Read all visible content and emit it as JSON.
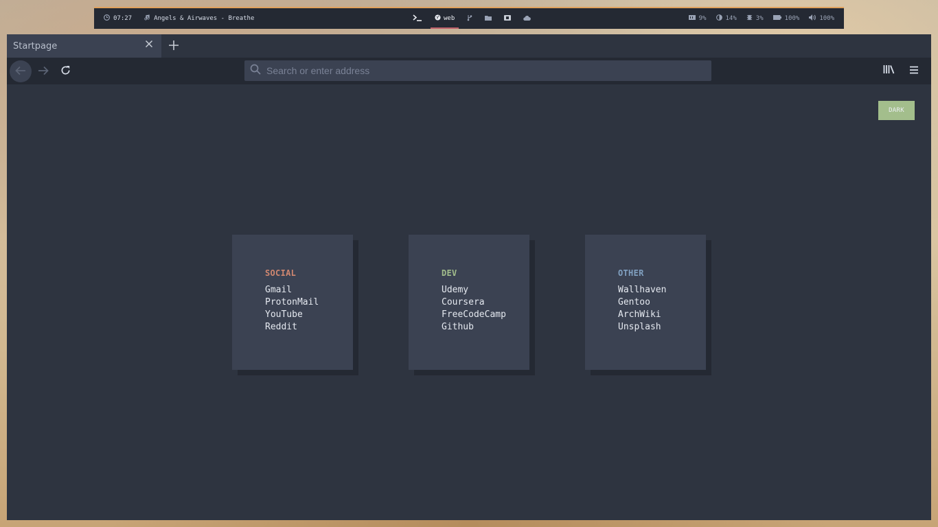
{
  "topbar": {
    "time": "07:27",
    "now_playing": "Angels & Airwaves - Breathe",
    "workspaces": [
      {
        "label": "",
        "icon": "terminal-icon"
      },
      {
        "label": "web",
        "icon": "globe-icon"
      },
      {
        "label": "",
        "icon": "git-branch-icon"
      },
      {
        "label": "",
        "icon": "folder-icon"
      },
      {
        "label": "",
        "icon": "film-icon"
      },
      {
        "label": "",
        "icon": "cloud-icon"
      }
    ],
    "stats": {
      "memory": "9%",
      "cpu": "14%",
      "disk": "3%",
      "battery": "100%",
      "volume": "100%"
    },
    "accent": "#bf616a"
  },
  "browser": {
    "tab_title": "Startpage",
    "url_placeholder": "Search or enter address"
  },
  "startpage": {
    "theme_button": "DARK",
    "theme_button_color": "#a3be8c",
    "cards": [
      {
        "title": "SOCIAL",
        "color": "#d08770",
        "links": [
          "Gmail",
          "ProtonMail",
          "YouTube",
          "Reddit"
        ]
      },
      {
        "title": "DEV",
        "color": "#a3be8c",
        "links": [
          "Udemy",
          "Coursera",
          "FreeCodeCamp",
          "Github"
        ]
      },
      {
        "title": "OTHER",
        "color": "#81a1c1",
        "links": [
          "Wallhaven",
          "Gentoo",
          "ArchWiki",
          "Unsplash"
        ]
      }
    ]
  }
}
